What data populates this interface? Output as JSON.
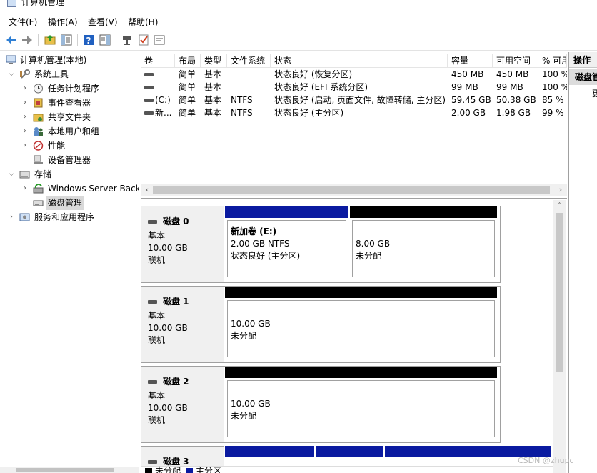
{
  "window": {
    "title": "计算机管理"
  },
  "menu": [
    "文件(F)",
    "操作(A)",
    "查看(V)",
    "帮助(H)"
  ],
  "toolbar": {
    "buttons": [
      "back-arrow-icon",
      "forward-arrow-icon",
      "up-folder-icon",
      "show-hide-tree-icon",
      "help-icon",
      "show-hide-action-icon",
      "connect-icon",
      "check-icon",
      "properties-icon"
    ]
  },
  "tree": {
    "root": "计算机管理(本地)",
    "system_tools": "系统工具",
    "task_scheduler": "任务计划程序",
    "event_viewer": "事件查看器",
    "shared_folders": "共享文件夹",
    "local_users": "本地用户和组",
    "performance": "性能",
    "device_manager": "设备管理器",
    "storage": "存储",
    "windows_backup": "Windows Server Back",
    "disk_management": "磁盘管理",
    "services_apps": "服务和应用程序"
  },
  "volume_list": {
    "headers": [
      "卷",
      "布局",
      "类型",
      "文件系统",
      "状态",
      "容量",
      "可用空间",
      "% 可用"
    ],
    "rows": [
      {
        "volume": "",
        "layout": "简单",
        "type": "基本",
        "fs": "",
        "status": "状态良好 (恢复分区)",
        "capacity": "450 MB",
        "free": "450 MB",
        "pct": "100 %"
      },
      {
        "volume": "",
        "layout": "简单",
        "type": "基本",
        "fs": "",
        "status": "状态良好 (EFI 系统分区)",
        "capacity": "99 MB",
        "free": "99 MB",
        "pct": "100 %"
      },
      {
        "volume": "(C:)",
        "layout": "简单",
        "type": "基本",
        "fs": "NTFS",
        "status": "状态良好 (启动, 页面文件, 故障转储, 主分区)",
        "capacity": "59.45 GB",
        "free": "50.38 GB",
        "pct": "85 %"
      },
      {
        "volume": "新...",
        "layout": "简单",
        "type": "基本",
        "fs": "NTFS",
        "status": "状态良好 (主分区)",
        "capacity": "2.00 GB",
        "free": "1.98 GB",
        "pct": "99 %"
      }
    ]
  },
  "disks": [
    {
      "name": "磁盘 0",
      "type": "基本",
      "size": "10.00 GB",
      "state": "联机",
      "partitions": [
        {
          "kind": "primary",
          "title": "新加卷  (E:)",
          "size": "2.00 GB NTFS",
          "status": "状态良好 (主分区)"
        },
        {
          "kind": "unallocated",
          "size": "8.00 GB",
          "status": "未分配"
        }
      ]
    },
    {
      "name": "磁盘 1",
      "type": "基本",
      "size": "10.00 GB",
      "state": "联机",
      "partitions": [
        {
          "kind": "unallocated",
          "size": "10.00 GB",
          "status": "未分配"
        }
      ]
    },
    {
      "name": "磁盘 2",
      "type": "基本",
      "size": "10.00 GB",
      "state": "联机",
      "partitions": [
        {
          "kind": "unallocated",
          "size": "10.00 GB",
          "status": "未分配"
        }
      ]
    },
    {
      "name": "磁盘 3"
    }
  ],
  "legend": {
    "unallocated": "未分配",
    "primary": "主分区",
    "unallocated_color": "#000000",
    "primary_color": "#0a1aa0"
  },
  "actions": {
    "header": "操作",
    "section": "磁盘管",
    "more": "更"
  },
  "watermark": "CSDN @zhupc"
}
